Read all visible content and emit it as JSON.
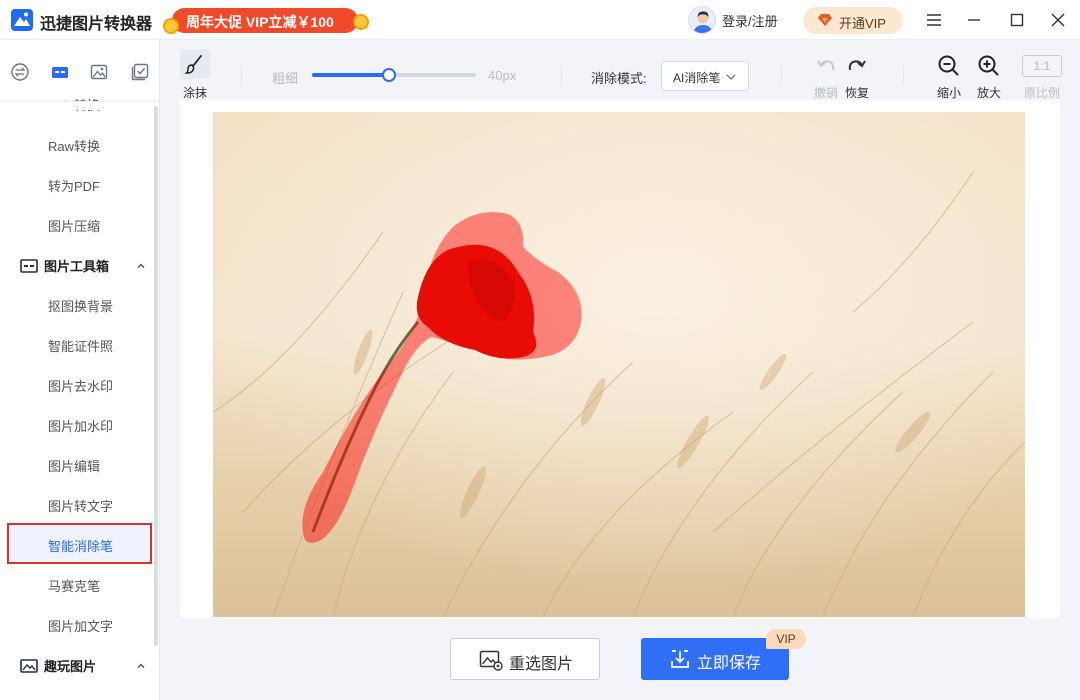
{
  "app": {
    "title": "迅捷图片转换器",
    "promo": "周年大促 VIP立减￥100",
    "login": "登录/注册",
    "vip_button": "开通VIP"
  },
  "window_controls": [
    "menu-icon",
    "minimize-icon",
    "maximize-icon",
    "close-icon"
  ],
  "sidebar": {
    "top_icons": [
      "convert-icon",
      "toolbox-icon",
      "image-icon",
      "check-image-icon"
    ],
    "active_top_icon": "toolbox-icon",
    "items_top": [
      {
        "label": "Heic转换"
      },
      {
        "label": "Raw转换"
      },
      {
        "label": "转为PDF"
      },
      {
        "label": "图片压缩"
      }
    ],
    "group_toolbox": "图片工具箱",
    "toolbox_items": [
      {
        "label": "抠图换背景"
      },
      {
        "label": "智能证件照"
      },
      {
        "label": "图片去水印"
      },
      {
        "label": "图片加水印"
      },
      {
        "label": "图片编辑"
      },
      {
        "label": "图片转文字"
      },
      {
        "label": "智能消除笔"
      },
      {
        "label": "马赛克笔"
      },
      {
        "label": "图片加文字"
      }
    ],
    "selected_item": "智能消除笔",
    "group_fun": "趣玩图片"
  },
  "toolbar": {
    "brush_label": "涂抹",
    "size_label": "粗细",
    "size_value": "40px",
    "size_fraction": 0.47,
    "mode_label": "消除模式:",
    "mode_value": "AI消除笔",
    "undo_label": "撤销",
    "redo_label": "恢复",
    "zoom_out_label": "缩小",
    "zoom_in_label": "放大",
    "ratio_box": "1:1",
    "ratio_label": "原比例"
  },
  "actions": {
    "reselect": "重选图片",
    "save": "立即保存",
    "vip_tag": "VIP"
  },
  "colors": {
    "accent": "#2f6ef5",
    "promo": "#f04a2a",
    "selection_outline": "#e0302b",
    "brush_mask": "#ff0000"
  }
}
